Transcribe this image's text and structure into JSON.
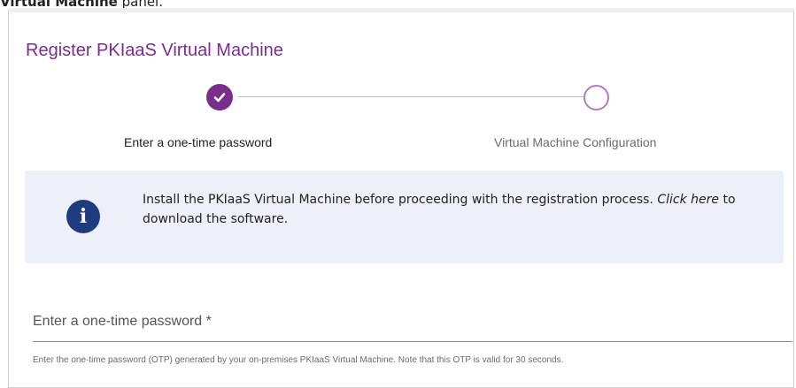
{
  "caption": {
    "bold_text": "Virtual Machine",
    "rest_text": " panel."
  },
  "panel": {
    "title": "Register PKIaaS Virtual Machine"
  },
  "stepper": {
    "steps": [
      {
        "label": "Enter a one-time password",
        "state": "completed"
      },
      {
        "label": "Virtual Machine Configuration",
        "state": "pending"
      }
    ],
    "active_color": "#7a2e8c"
  },
  "info": {
    "icon": "info-icon",
    "text_before": "Install the PKIaaS Virtual Machine before proceeding with the registration process. ",
    "link_text": "Click here",
    "text_after": " to download the software."
  },
  "otp": {
    "label": "Enter a one-time password *",
    "value": "",
    "help": "Enter the one-time password (OTP) generated by your on-premises PKIaaS Virtual Machine. Note that this OTP is valid for 30 seconds."
  }
}
